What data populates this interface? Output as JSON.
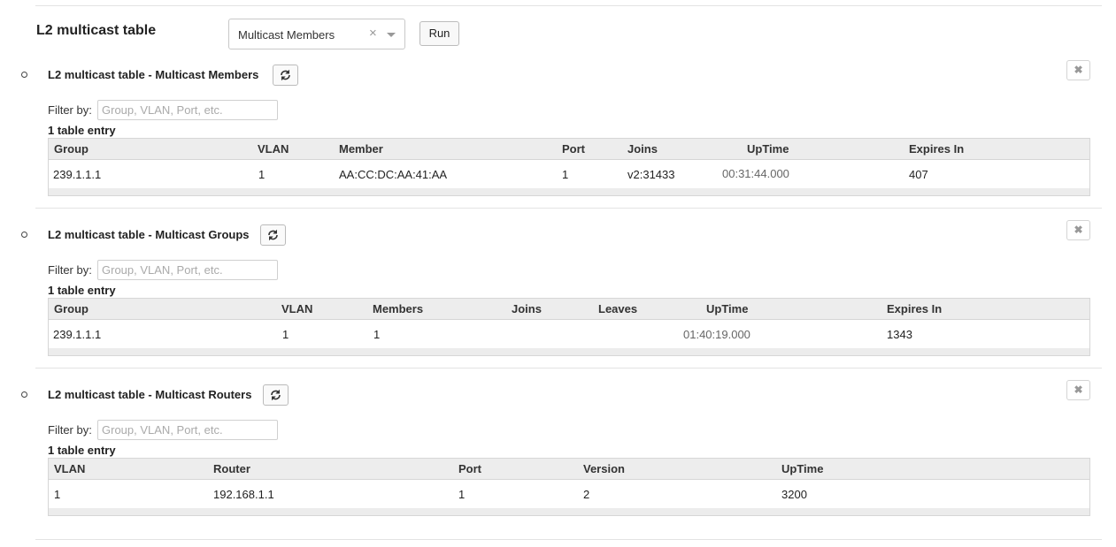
{
  "header": {
    "title": "L2 multicast table",
    "select_value": "Multicast Members",
    "clear_glyph": "×",
    "run_label": "Run"
  },
  "icons": {
    "refresh": "refresh-icon",
    "close": "close-icon",
    "clear": "clear-icon",
    "chevron": "chevron-down-icon"
  },
  "filter_label": "Filter by:",
  "filter_placeholder": "Group, VLAN, Port, etc.",
  "close_glyph": "✖",
  "members": {
    "title": "L2 multicast table - Multicast Members",
    "count": "1 table entry",
    "columns": [
      "Group",
      "VLAN",
      "Member",
      "Port",
      "Joins",
      "UpTime",
      "Expires In"
    ],
    "rows": [
      [
        "239.1.1.1",
        "1",
        "AA:CC:DC:AA:41:AA",
        "1",
        "v2:31433",
        "00:31:44.000",
        "407"
      ]
    ]
  },
  "groups": {
    "title": "L2 multicast table - Multicast Groups",
    "count": "1 table entry",
    "columns": [
      "Group",
      "VLAN",
      "Members",
      "Joins",
      "Leaves",
      "UpTime",
      "Expires In"
    ],
    "rows": [
      [
        "239.1.1.1",
        "1",
        "1",
        "",
        "",
        "01:40:19.000",
        "1343"
      ]
    ]
  },
  "routers": {
    "title": "L2 multicast table - Multicast Routers",
    "count": "1 table entry",
    "columns": [
      "VLAN",
      "Router",
      "Port",
      "Version",
      "UpTime"
    ],
    "rows": [
      [
        "1",
        "192.168.1.1",
        "1",
        "2",
        "3200"
      ]
    ]
  }
}
